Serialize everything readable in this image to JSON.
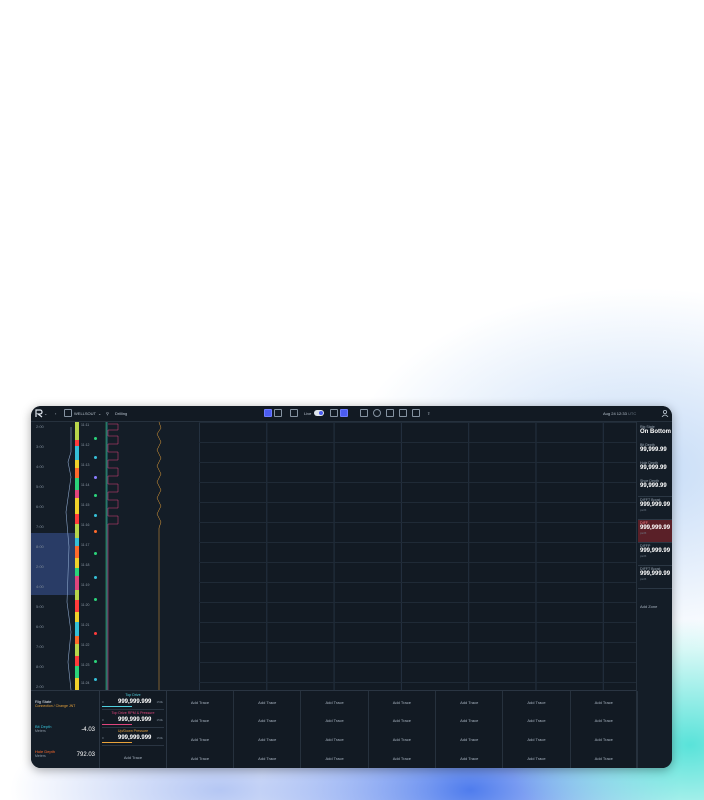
{
  "topbar": {
    "well_name": "WELLSOUT",
    "activity": "Drilling",
    "live_label": "Live",
    "datetime": "Aug 24 12:33",
    "timezone": "UTC"
  },
  "time_axis": {
    "labels_left": [
      "2:00",
      "3:00",
      "4:00",
      "5:00",
      "6:00",
      "7:00",
      "8:00",
      "2:00",
      "4:00",
      "5:00",
      "6:00",
      "7:00",
      "8:00",
      "2:00"
    ],
    "labels_right": [
      "11:11",
      "11:12",
      "11:13",
      "11:14",
      "11:15",
      "11:16",
      "11:17",
      "11:18",
      "11:19",
      "11:20",
      "11:21",
      "11:22",
      "11:23",
      "11:24"
    ]
  },
  "right_panel": {
    "rig_state": {
      "label": "Rig State",
      "value": "On Bottom"
    },
    "bit_depth": {
      "label": "Bit Depth",
      "value": "99,999.99"
    },
    "hole_depth": {
      "label": "Hole Depth",
      "value": "99,999.99"
    },
    "shoe_depth": {
      "label": "Shoe Depth",
      "value": "99,999.99"
    },
    "diff_boost_1": {
      "label": "DIFFT Boost",
      "value": "999,999.99",
      "unit": "psi/ft"
    },
    "diff": {
      "label": "DIFF",
      "value": "999,999.99",
      "unit": "psi/ft"
    },
    "diffp": {
      "label": "DIFFP",
      "value": "999,999.99",
      "unit": "psi/ft"
    },
    "diff_boost_2": {
      "label": "DIFFT Boost",
      "value": "999,999.99",
      "unit": "psi/ft"
    },
    "add_zone": "Add Zone"
  },
  "status": {
    "rig_state": {
      "label": "Rig State",
      "sub": "Connection / Change JNT"
    },
    "bit_depth": {
      "label": "Bit Depth",
      "sub": "Meters",
      "value": "-4.03"
    },
    "hole_depth": {
      "label": "Hole Depth",
      "sub": "Meters",
      "value": "792.03"
    }
  },
  "traces": [
    {
      "name": "Top Drive",
      "min": "0",
      "value": "999,999.999",
      "max": "150k",
      "color": "#4fd1e0"
    },
    {
      "name": "Top Drive RPM & Pressure",
      "min": "0",
      "value": "999,999.999",
      "max": "150k",
      "color": "#e0457d"
    },
    {
      "name": "Up/Down Pressure",
      "min": "0",
      "value": "999,999.999",
      "max": "150k",
      "color": "#e8a23a"
    }
  ],
  "add_trace_label": "Add Trace",
  "colors": {
    "accent": "#4b5cf0",
    "background": "#0f1720"
  }
}
